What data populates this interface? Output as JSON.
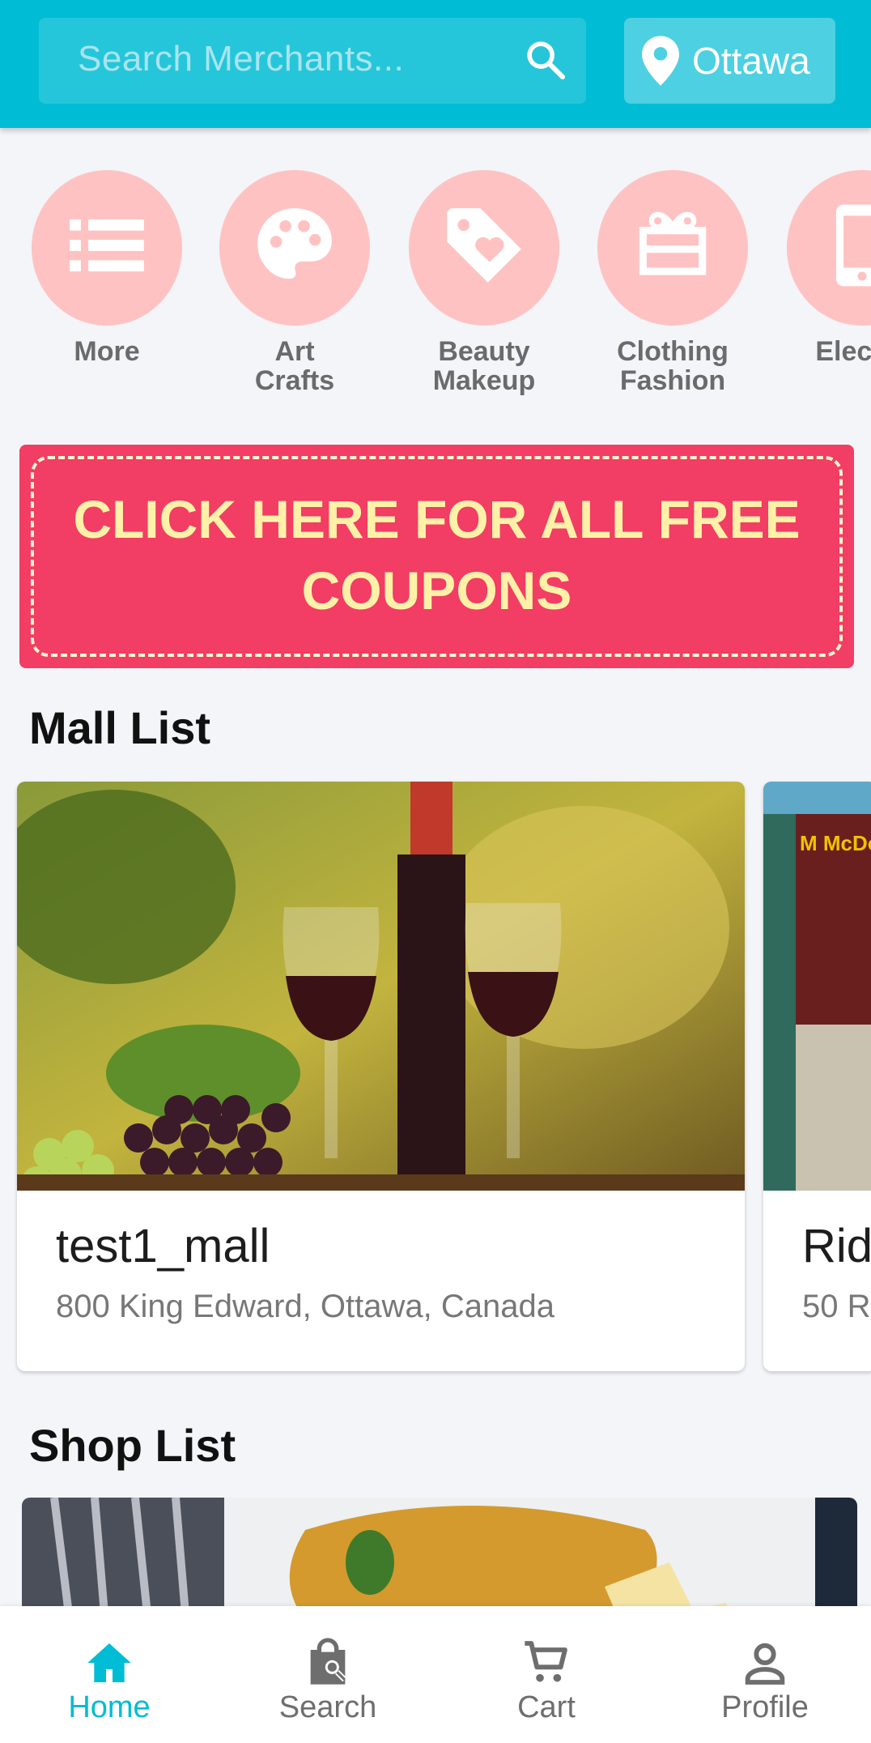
{
  "header": {
    "search_placeholder": "Search Merchants...",
    "location": "Ottawa",
    "icons": {
      "search": "search-icon",
      "location": "location-pin-icon"
    },
    "colors": {
      "bar": "#00bcd4",
      "search_bg": "#26c6da",
      "location_bg": "#4dd0e1"
    }
  },
  "categories": [
    {
      "label": "More",
      "icon": "list-icon"
    },
    {
      "label": "Art\nCrafts",
      "icon": "palette-icon"
    },
    {
      "label": "Beauty\nMakeup",
      "icon": "tag-heart-icon"
    },
    {
      "label": "Clothing\nFashion",
      "icon": "gift-icon"
    },
    {
      "label": "Electro",
      "icon": "phone-icon"
    }
  ],
  "coupon_banner": {
    "text": "CLICK HERE FOR ALL FREE COUPONS",
    "colors": {
      "bg": "#f23d64",
      "text": "#fff2a8"
    }
  },
  "mall_section": {
    "title": "Mall List",
    "malls": [
      {
        "name": "test1_mall",
        "address": "800 King Edward, Ottawa, Canada"
      },
      {
        "name": "Rid",
        "address": "50 R"
      }
    ]
  },
  "shop_section": {
    "title": "Shop List"
  },
  "bottom_nav": {
    "items": [
      {
        "label": "Home",
        "icon": "home-icon",
        "active": true
      },
      {
        "label": "Search",
        "icon": "search-bag-icon",
        "active": false
      },
      {
        "label": "Cart",
        "icon": "cart-icon",
        "active": false
      },
      {
        "label": "Profile",
        "icon": "person-icon",
        "active": false
      }
    ],
    "active_color": "#00bcd4"
  }
}
